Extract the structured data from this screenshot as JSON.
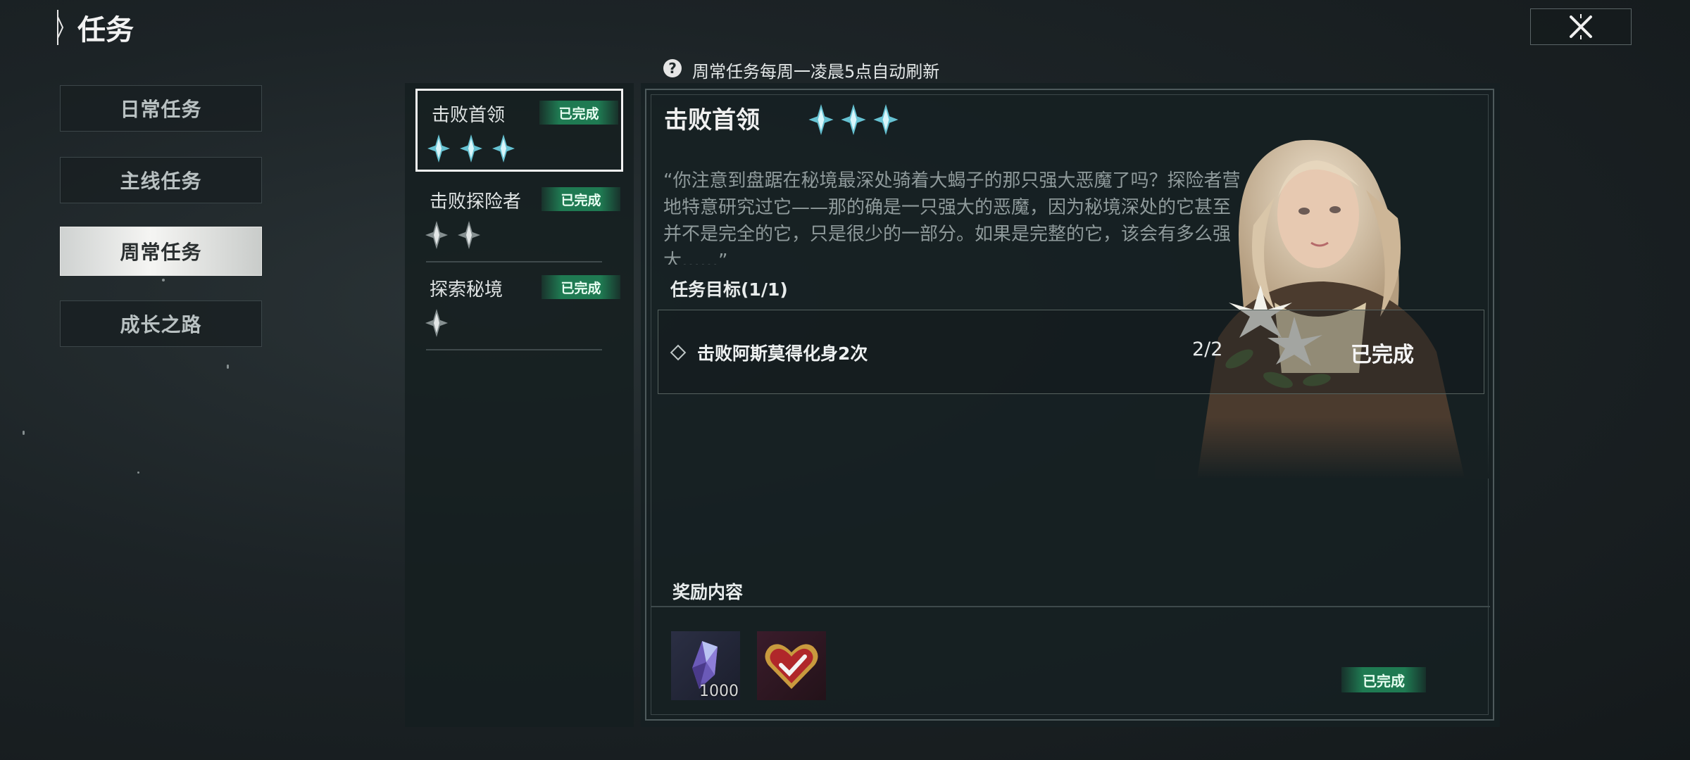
{
  "header": {
    "title": "任务"
  },
  "nav": {
    "items": [
      {
        "label": "日常任务",
        "active": false
      },
      {
        "label": "主线任务",
        "active": false
      },
      {
        "label": "周常任务",
        "active": true
      },
      {
        "label": "成长之路",
        "active": false
      }
    ]
  },
  "info": {
    "text": "周常任务每周一凌晨5点自动刷新",
    "icon": "question-icon"
  },
  "tasks": [
    {
      "name": "击败首领",
      "status": "已完成",
      "stars": 3,
      "selected": true
    },
    {
      "name": "击败探险者",
      "status": "已完成",
      "stars": 2,
      "selected": false
    },
    {
      "name": "探索秘境",
      "status": "已完成",
      "stars": 1,
      "selected": false
    }
  ],
  "detail": {
    "title": "击败首领",
    "stars": 3,
    "description": "“你注意到盘踞在秘境最深处骑着大蝎子的那只强大恶魔了吗？探险者营地特意研究过它——那的确是一只强大的恶魔，因为秘境深处的它甚至并不是完全的它，只是很少的一部分。如果是完整的它，该会有多么强大……”",
    "objective_header": "任务目标(1/1)",
    "objective": {
      "text": "击败阿斯莫得化身2次",
      "progress": "2/2",
      "status": "已完成"
    },
    "reward_header": "奖励内容",
    "rewards": [
      {
        "name": "crystal-gem-icon",
        "qty": "1000"
      },
      {
        "name": "heart-check-icon",
        "qty": ""
      }
    ],
    "reward_status": "已完成"
  },
  "colors": {
    "badge_green": "#1f7a52",
    "star_cyan": "#6fd4e6",
    "star_dim": "#9aa3a4"
  }
}
